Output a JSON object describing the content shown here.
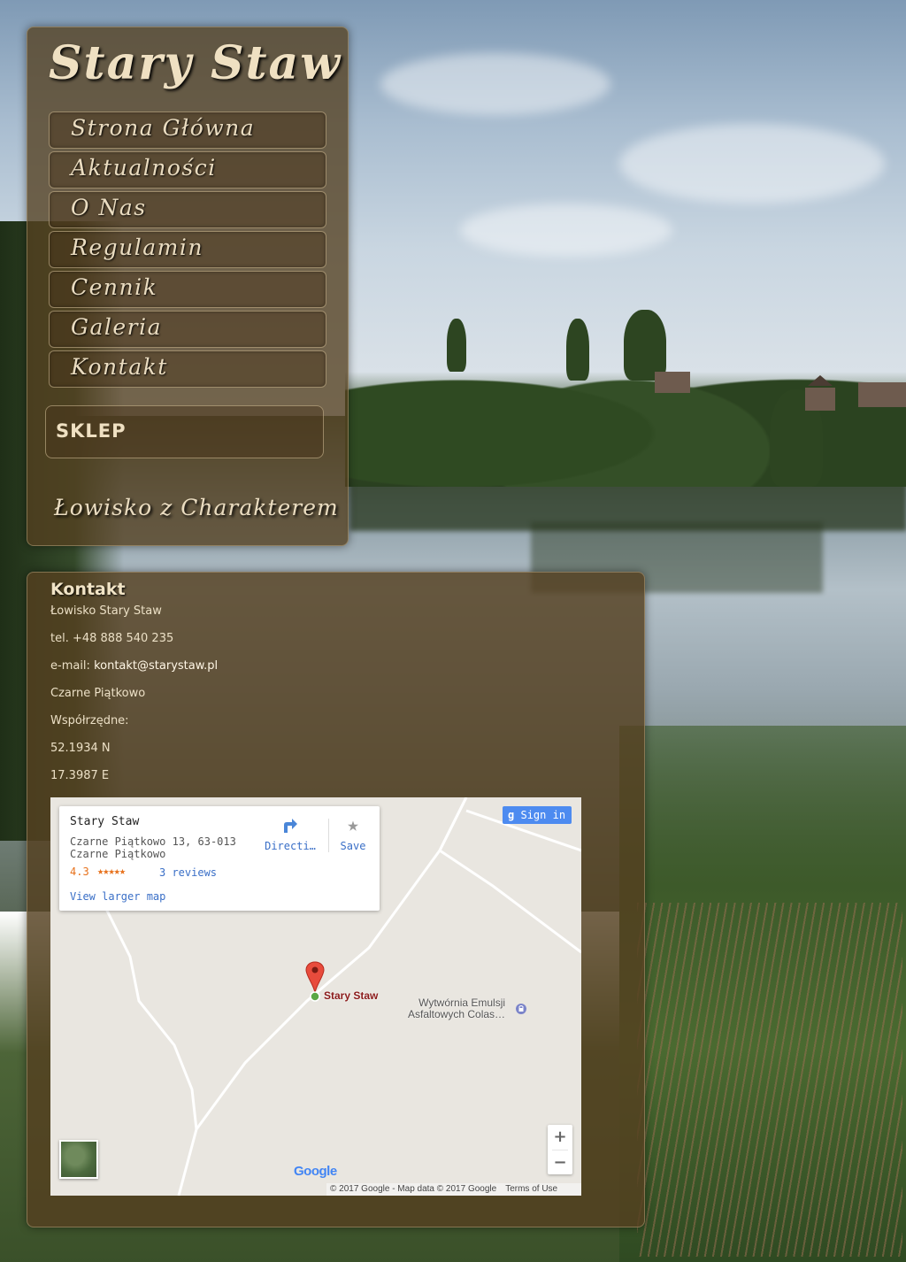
{
  "site": {
    "title": "Stary Staw",
    "tagline": "Łowisko z Charakterem"
  },
  "nav": {
    "items": [
      {
        "label": "Strona Główna"
      },
      {
        "label": "Aktualności"
      },
      {
        "label": "O Nas"
      },
      {
        "label": "Regulamin"
      },
      {
        "label": "Cennik"
      },
      {
        "label": "Galeria"
      },
      {
        "label": "Kontakt"
      }
    ],
    "shop_label": "SKLEP"
  },
  "contact": {
    "heading": "Kontakt",
    "name": "Łowisko Stary Staw",
    "phone": "tel. +48 888 540 235",
    "email_prefix": "e-mail: ",
    "email": "kontakt@starystaw.pl",
    "locality": "Czarne Piątkowo",
    "coords_label": "Współrzędne:",
    "lat": "52.1934 N",
    "lon": "17.3987 E"
  },
  "map": {
    "place_name": "Stary Staw",
    "address": "Czarne Piątkowo 13, 63-013 Czarne Piątkowo",
    "rating": "4.3",
    "stars": "★★★★★",
    "reviews": "3 reviews",
    "view_larger": "View larger map",
    "directions_label": "Directi…",
    "save_label": "Save",
    "signin_g": "g",
    "signin_label": "Sign in",
    "pin_label": "Stary Staw",
    "poi_label_line1": "Wytwórnia Emulsji",
    "poi_label_line2": "Asfaltowych Colas…",
    "zoom_in": "+",
    "zoom_out": "−",
    "google_logo": "Google",
    "attribution": "© 2017 Google - Map data © 2017 Google",
    "terms": "Terms of Use",
    "icons": {
      "directions": "directions-icon",
      "save": "star-icon",
      "pin": "map-pin-icon",
      "poi": "poi-icon"
    }
  },
  "colors": {
    "panel": "#54401f",
    "text_light": "#efe0c2",
    "link_blue": "#3a6fc7",
    "rating_orange": "#e7711b",
    "signin_blue": "#4d8bf0"
  }
}
